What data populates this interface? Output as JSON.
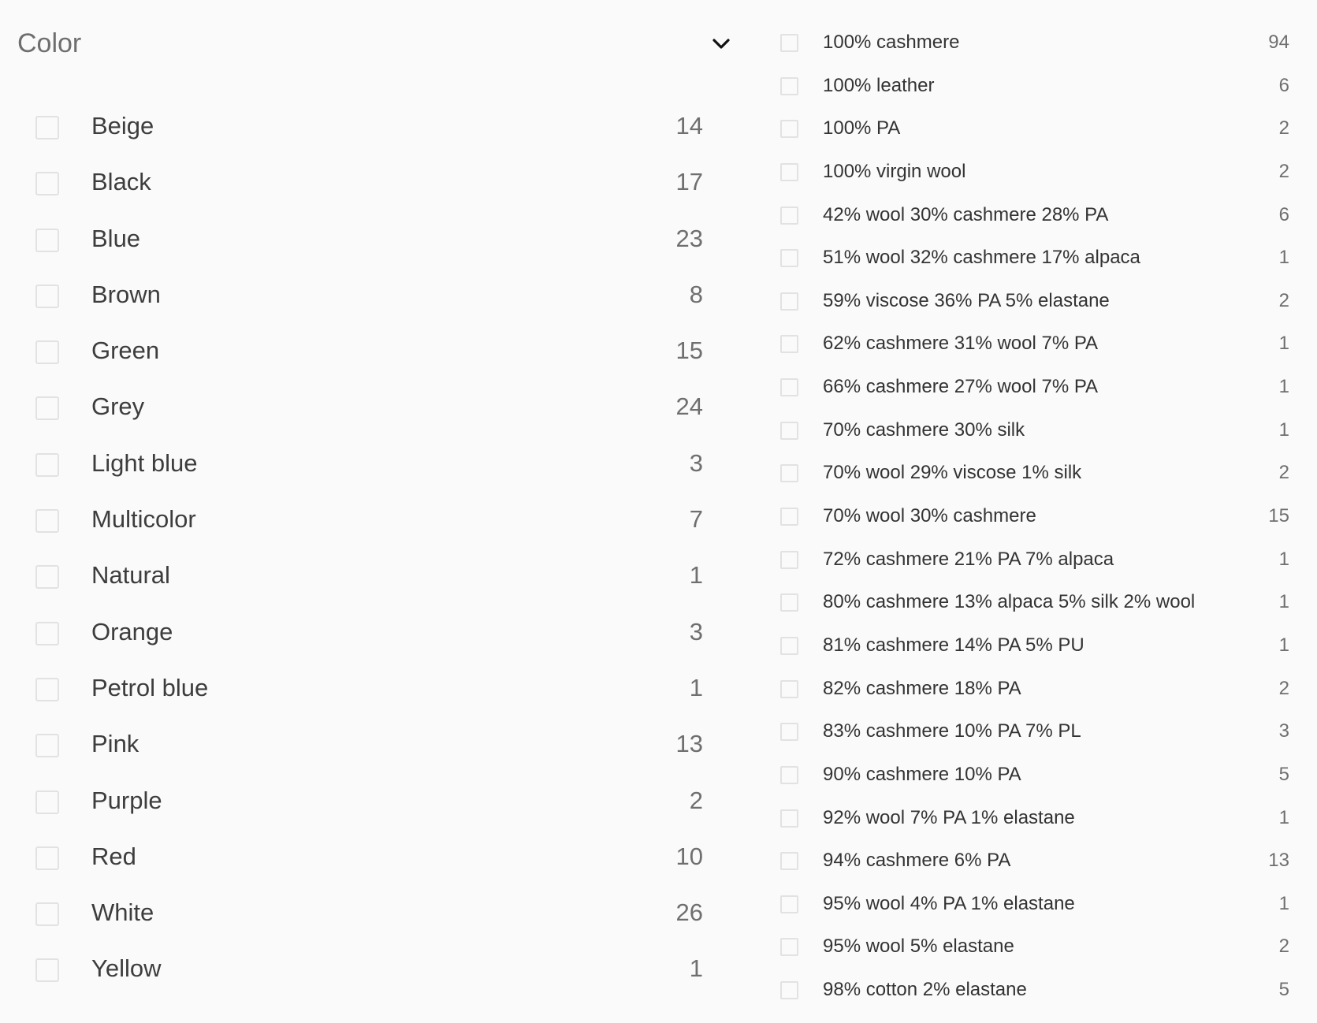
{
  "color_filter": {
    "title": "Color",
    "toggle_icon": "chevron-down-icon",
    "items": [
      {
        "label": "Beige",
        "count": "14"
      },
      {
        "label": "Black",
        "count": "17"
      },
      {
        "label": "Blue",
        "count": "23"
      },
      {
        "label": "Brown",
        "count": "8"
      },
      {
        "label": "Green",
        "count": "15"
      },
      {
        "label": "Grey",
        "count": "24"
      },
      {
        "label": "Light blue",
        "count": "3"
      },
      {
        "label": "Multicolor",
        "count": "7"
      },
      {
        "label": "Natural",
        "count": "1"
      },
      {
        "label": "Orange",
        "count": "3"
      },
      {
        "label": "Petrol blue",
        "count": "1"
      },
      {
        "label": "Pink",
        "count": "13"
      },
      {
        "label": "Purple",
        "count": "2"
      },
      {
        "label": "Red",
        "count": "10"
      },
      {
        "label": "White",
        "count": "26"
      },
      {
        "label": "Yellow",
        "count": "1"
      }
    ]
  },
  "material_filter": {
    "items": [
      {
        "label": "100% cashmere",
        "count": "94"
      },
      {
        "label": "100% leather",
        "count": "6"
      },
      {
        "label": "100% PA",
        "count": "2"
      },
      {
        "label": "100% virgin wool",
        "count": "2"
      },
      {
        "label": "42% wool 30% cashmere 28% PA",
        "count": "6"
      },
      {
        "label": "51% wool 32% cashmere 17% alpaca",
        "count": "1"
      },
      {
        "label": "59% viscose 36% PA 5% elastane",
        "count": "2"
      },
      {
        "label": "62% cashmere 31% wool 7% PA",
        "count": "1"
      },
      {
        "label": "66% cashmere 27% wool 7% PA",
        "count": "1"
      },
      {
        "label": "70% cashmere 30% silk",
        "count": "1"
      },
      {
        "label": "70% wool 29% viscose 1% silk",
        "count": "2"
      },
      {
        "label": "70% wool 30% cashmere",
        "count": "15"
      },
      {
        "label": "72% cashmere 21% PA 7% alpaca",
        "count": "1"
      },
      {
        "label": "80% cashmere 13% alpaca 5% silk 2% wool",
        "count": "1"
      },
      {
        "label": "81% cashmere 14% PA 5% PU",
        "count": "1"
      },
      {
        "label": "82% cashmere 18% PA",
        "count": "2"
      },
      {
        "label": "83% cashmere 10% PA 7% PL",
        "count": "3"
      },
      {
        "label": "90% cashmere 10% PA",
        "count": "5"
      },
      {
        "label": "92% wool 7% PA 1% elastane",
        "count": "1"
      },
      {
        "label": "94% cashmere 6% PA",
        "count": "13"
      },
      {
        "label": "95% wool 4% PA 1% elastane",
        "count": "1"
      },
      {
        "label": "95% wool 5% elastane",
        "count": "2"
      },
      {
        "label": "98% cotton 2% elastane",
        "count": "5"
      }
    ]
  },
  "colors": {
    "background": "#fafafa",
    "checkbox_border": "#e2e2e2",
    "label_text": "#3d3d3d",
    "count_text": "#6f6f6f",
    "title_text": "#6e6e6e"
  }
}
